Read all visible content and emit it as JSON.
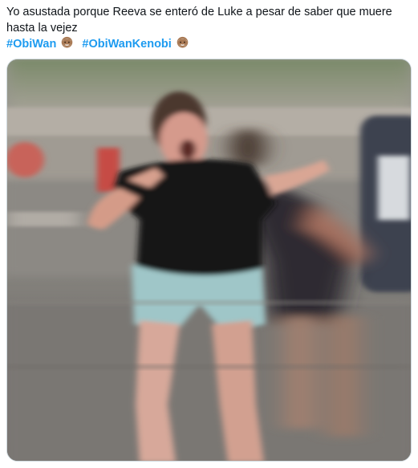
{
  "tweet": {
    "text_line1": "Yo asustada porque Reeva se enteró de Luke a pesar de saber que muere",
    "text_line2": "hasta la vejez",
    "hashtags": [
      {
        "label": "#ObiWan",
        "emoji": "old-man-bearded-emoji"
      },
      {
        "label": "#ObiWanKenobi",
        "emoji": "old-man-bearded-emoji"
      }
    ]
  },
  "media": {
    "type": "photo",
    "icon": "meme-photo"
  },
  "colors": {
    "hashtag": "#1d9bf0",
    "text": "#0f1419",
    "border": "#cfd9de"
  }
}
